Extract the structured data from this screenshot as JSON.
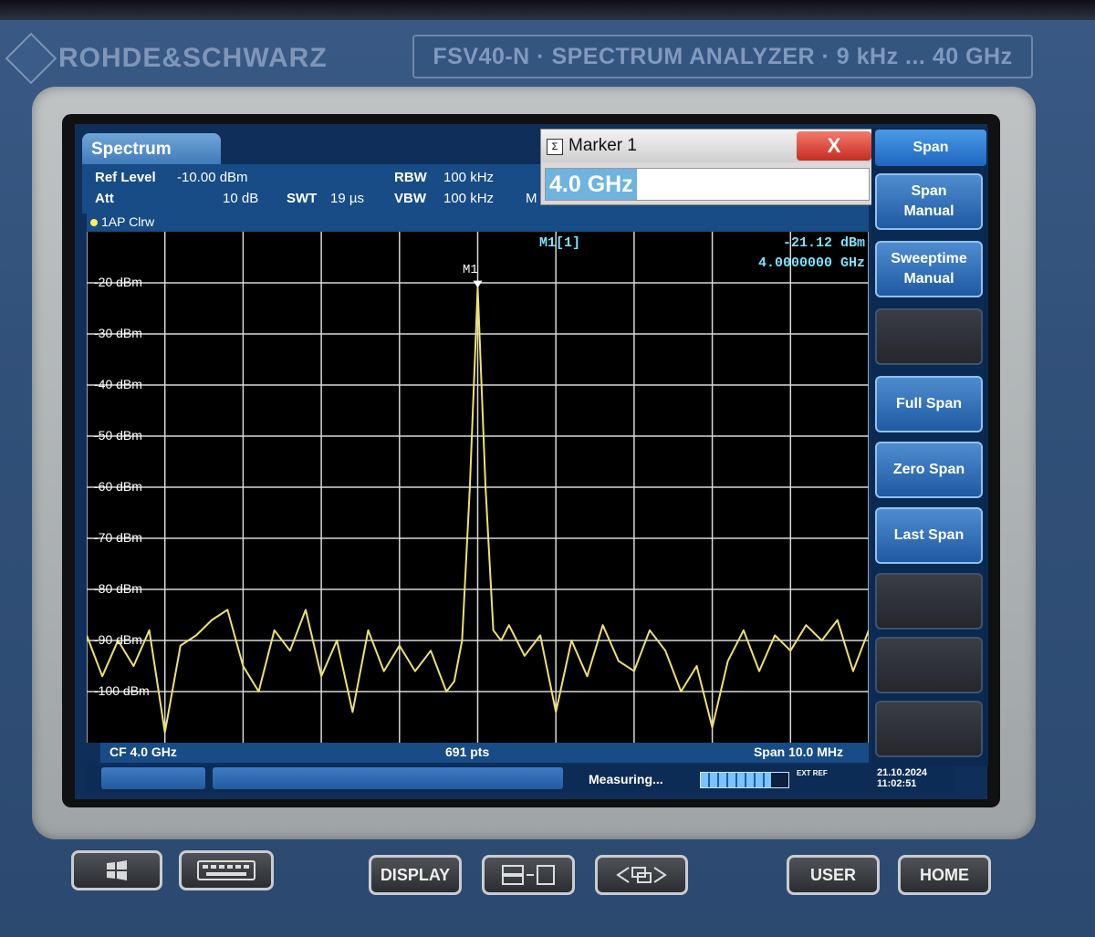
{
  "device": {
    "brand": "ROHDE&SCHWARZ",
    "model_plate": "FSV40-N · SPECTRUM ANALYZER · 9 kHz ... 40 GHz"
  },
  "header": {
    "tab": "Spectrum",
    "ref_level_label": "Ref Level",
    "ref_level_value": "-10.00 dBm",
    "att_label": "Att",
    "att_value": "10 dB",
    "swt_label": "SWT",
    "swt_value": "19 µs",
    "rbw_label": "RBW",
    "rbw_value": "100 kHz",
    "vbw_label": "VBW",
    "vbw_value": "100 kHz",
    "mode_truncated": "M"
  },
  "trace": {
    "label": "1AP Clrw",
    "color": "#f0e070"
  },
  "marker": {
    "id": "M1",
    "readout_title": "M1[1]",
    "readout_level": "-21.12 dBm",
    "readout_freq": "4.0000000 GHz"
  },
  "marker_dialog": {
    "title": "Marker 1",
    "value": "4.0 GHz",
    "close_label": "X"
  },
  "y_axis": [
    "-20 dBm",
    "-30 dBm",
    "-40 dBm",
    "-50 dBm",
    "-60 dBm",
    "-70 dBm",
    "-80 dBm",
    "-90 dBm",
    "-100 dBm"
  ],
  "footer": {
    "cf": "CF 4.0 GHz",
    "points": "691 pts",
    "span": "Span 10.0 MHz"
  },
  "status": {
    "message": "Measuring...",
    "progress": 0.8,
    "ext_ref": "EXT REF",
    "date": "21.10.2024",
    "time": "11:02:51"
  },
  "softkeys": {
    "title": "Span",
    "items": [
      "Span\nManual",
      "Sweeptime\nManual",
      "",
      "Full Span",
      "Zero Span",
      "Last Span",
      "",
      "",
      ""
    ]
  },
  "hardware_buttons": {
    "display": "DISPLAY",
    "user": "USER",
    "home": "HOME"
  },
  "chart_data": {
    "type": "line",
    "x_unit": "MHz offset from CF",
    "xlim": [
      -5,
      5
    ],
    "ylim": [
      -110,
      -10
    ],
    "ylabel_ticks": [
      -20,
      -30,
      -40,
      -50,
      -60,
      -70,
      -80,
      -90,
      -100
    ],
    "series": [
      {
        "x": [
          -5.0,
          -4.8,
          -4.6,
          -4.4,
          -4.2,
          -4.0,
          -3.8,
          -3.6,
          -3.4,
          -3.2,
          -3.0,
          -2.8,
          -2.6,
          -2.4,
          -2.2,
          -2.0,
          -1.8,
          -1.6,
          -1.4,
          -1.2,
          -1.0,
          -0.8,
          -0.6,
          -0.4,
          -0.3,
          -0.2,
          -0.1,
          0.0,
          0.1,
          0.2,
          0.3,
          0.4,
          0.6,
          0.8,
          1.0,
          1.2,
          1.4,
          1.6,
          1.8,
          2.0,
          2.2,
          2.4,
          2.6,
          2.8,
          3.0,
          3.2,
          3.4,
          3.6,
          3.8,
          4.0,
          4.2,
          4.4,
          4.6,
          4.8,
          5.0
        ],
        "y": [
          -89,
          -97,
          -90,
          -95,
          -88,
          -108,
          -91,
          -89,
          -86,
          -84,
          -95,
          -100,
          -88,
          -92,
          -84,
          -97,
          -90,
          -104,
          -88,
          -96,
          -91,
          -96,
          -92,
          -100,
          -98,
          -90,
          -60,
          -21,
          -60,
          -88,
          -90,
          -87,
          -93,
          -89,
          -104,
          -90,
          -97,
          -87,
          -94,
          -96,
          -88,
          -92,
          -100,
          -95,
          -107,
          -94,
          -88,
          -96,
          -89,
          -92,
          -87,
          -90,
          -86,
          -96,
          -88
        ]
      }
    ]
  }
}
